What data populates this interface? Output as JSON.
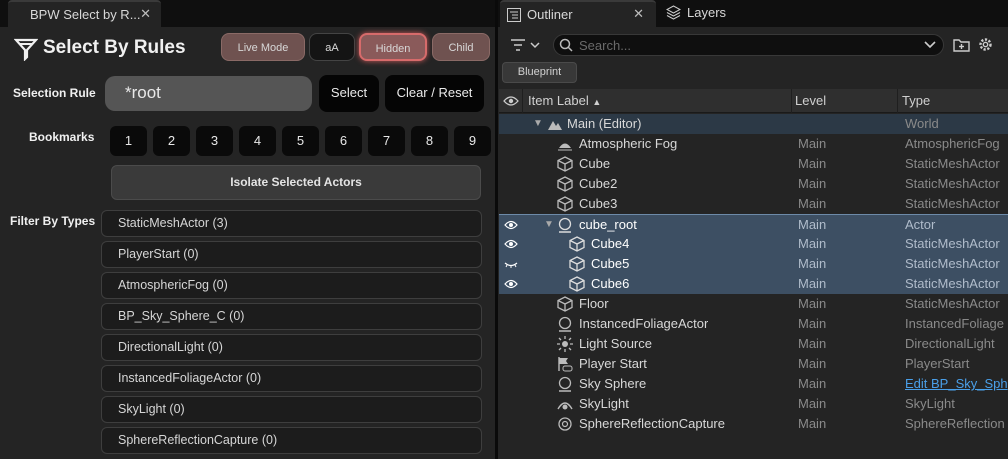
{
  "left_panel": {
    "tab_title": "BPW Select by R...",
    "tab_close": "✕",
    "title": "Select By Rules",
    "modes": {
      "live": "Live Mode",
      "aa": "aA",
      "hidden": "Hidden",
      "child": "Child"
    },
    "selection_rule_label": "Selection Rule",
    "rule_value": "*root",
    "select_button": "Select",
    "clear_button": "Clear / Reset",
    "bookmarks_label": "Bookmarks",
    "bookmarks": [
      "1",
      "2",
      "3",
      "4",
      "5",
      "6",
      "7",
      "8",
      "9"
    ],
    "isolate_button": "Isolate Selected Actors",
    "filter_label": "Filter By Types",
    "types": [
      "StaticMeshActor  (3)",
      "PlayerStart  (0)",
      "AtmosphericFog  (0)",
      "BP_Sky_Sphere_C  (0)",
      "DirectionalLight  (0)",
      "InstancedFoliageActor  (0)",
      "SkyLight  (0)",
      "SphereReflectionCapture  (0)"
    ]
  },
  "outliner": {
    "tab_title": "Outliner",
    "tab_close": "✕",
    "layers_tab": "Layers",
    "search_placeholder": "Search...",
    "blueprint_button": "Blueprint",
    "columns": {
      "label": "Item Label",
      "level": "Level",
      "type": "Type"
    },
    "rows": [
      {
        "label": "Main (Editor)",
        "level": "",
        "type": "World",
        "icon": "world-icon"
      },
      {
        "label": "Atmospheric Fog",
        "level": "Main",
        "type": "AtmosphericFog",
        "icon": "fog-icon"
      },
      {
        "label": "Cube",
        "level": "Main",
        "type": "StaticMeshActor",
        "icon": "mesh-icon"
      },
      {
        "label": "Cube2",
        "level": "Main",
        "type": "StaticMeshActor",
        "icon": "mesh-icon"
      },
      {
        "label": "Cube3",
        "level": "Main",
        "type": "StaticMeshActor",
        "icon": "mesh-icon"
      },
      {
        "label": "cube_root",
        "level": "Main",
        "type": "Actor",
        "icon": "actor-icon"
      },
      {
        "label": "Cube4",
        "level": "Main",
        "type": "StaticMeshActor",
        "icon": "mesh-icon"
      },
      {
        "label": "Cube5",
        "level": "Main",
        "type": "StaticMeshActor",
        "icon": "mesh-icon"
      },
      {
        "label": "Cube6",
        "level": "Main",
        "type": "StaticMeshActor",
        "icon": "mesh-icon"
      },
      {
        "label": "Floor",
        "level": "Main",
        "type": "StaticMeshActor",
        "icon": "mesh-icon"
      },
      {
        "label": "InstancedFoliageActor",
        "level": "Main",
        "type": "InstancedFoliage",
        "icon": "actor-icon"
      },
      {
        "label": "Light Source",
        "level": "Main",
        "type": "DirectionalLight",
        "icon": "sun-icon"
      },
      {
        "label": "Player Start",
        "level": "Main",
        "type": "PlayerStart",
        "icon": "gamepad-icon"
      },
      {
        "label": "Sky Sphere",
        "level": "Main",
        "type": "Edit BP_Sky_Sph",
        "icon": "actor-icon"
      },
      {
        "label": "SkyLight",
        "level": "Main",
        "type": "SkyLight",
        "icon": "skylight-icon"
      },
      {
        "label": "SphereReflectionCapture",
        "level": "Main",
        "type": "SphereReflection",
        "icon": "reflection-icon"
      }
    ]
  },
  "colors": {
    "selected_row": "#3d4f63",
    "hidden_accent": "#d76b6b",
    "link": "#4a9fe8"
  }
}
